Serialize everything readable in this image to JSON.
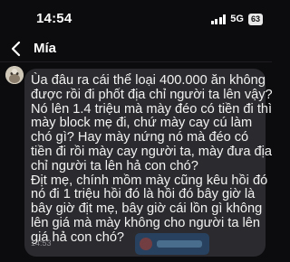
{
  "status": {
    "time": "14:54",
    "network": "5G",
    "battery": "63"
  },
  "header": {
    "contact_name": "Mía"
  },
  "message": {
    "lines": [
      "Ùa đâu ra cái thể loại 400.000 ăn không",
      "được rồi đi phốt địa chỉ người ta lên vậy?",
      "Nó lên 1.4 triệu mà mày đéo có tiền đi thì",
      "mày block mẹ đi, chứ mày cay cú làm",
      "chó gì? Hay mày nứng nó mà đéo có",
      "tiền đi rồi mày cay người ta, mày đưa địa",
      "chỉ người ta lên hả con chó?",
      "Địt mẹ, chính mồm mày cũng kêu hồi đó",
      "nó đi 1 triệu hồi đó là hồi đó bây giờ là",
      "bây giờ địt mẹ, bây giờ cái lồn gì không",
      "lên giá mà mày không cho người ta lên",
      "giá hả con chó?"
    ],
    "time": "14:53"
  },
  "icons": {
    "back": "chevron-left-icon",
    "signal": "signal-bars-icon",
    "battery": "battery-icon",
    "avatar": "avatar-image",
    "watermark": "watermark-logo"
  }
}
